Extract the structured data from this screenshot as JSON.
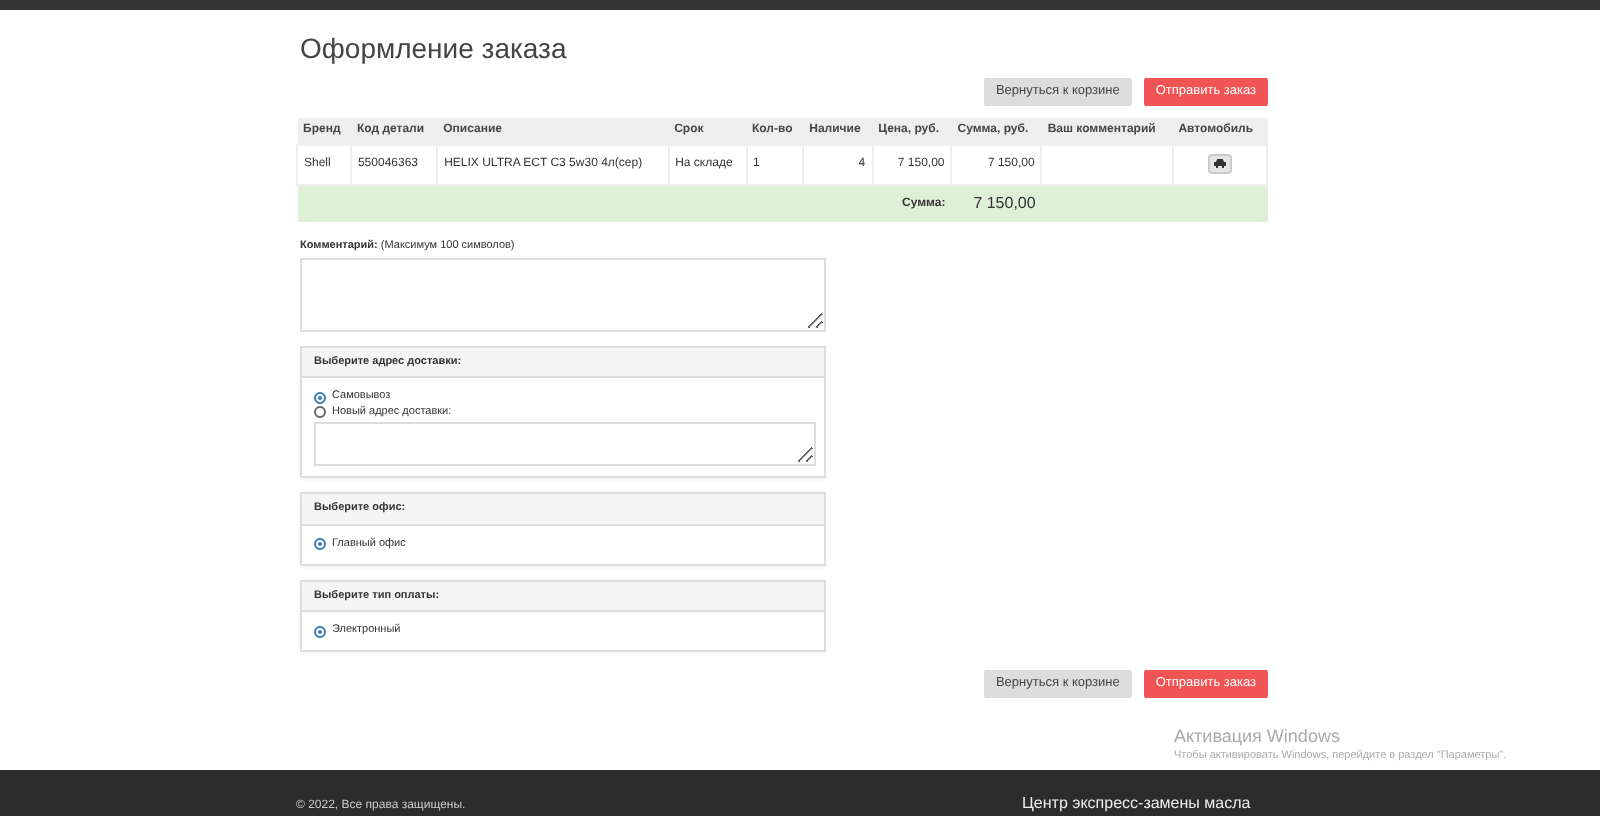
{
  "title": "Оформление заказа",
  "top_buttons": [
    {
      "kind": "back",
      "label": "Вернуться к корзине"
    },
    {
      "kind": "submit",
      "label": "Отправить заказ"
    }
  ],
  "table": {
    "columns": [
      "Бренд",
      "Код детали",
      "Описание",
      "Срок",
      "Кол-во",
      "Наличие",
      "Цена, руб.",
      "Сумма, руб.",
      "Ваш комментарий",
      "Автомобиль"
    ],
    "rows": [
      [
        "Shell",
        "550046363",
        "HELIX ULTRA ECT C3 5w30 4л(сер)",
        "На складе",
        "1",
        "4",
        "7 150,00",
        "7 150,00",
        ""
      ]
    ],
    "total_label": "Сумма:",
    "total_value": "7 150,00"
  },
  "comment": {
    "label": "Комментарий:",
    "hint": "(Максимум 100 символов)"
  },
  "panels": [
    {
      "title": "Выберите адрес доставки:",
      "options": [
        {
          "kind": "radio",
          "label": "Самовывоз",
          "selected": true
        },
        {
          "kind": "radio_with_field",
          "label": "Новый адрес доставки:",
          "selected": false
        }
      ]
    },
    {
      "title": "Выберите офис:",
      "options": [
        {
          "kind": "radio",
          "label": "Главный офис",
          "selected": true
        }
      ]
    },
    {
      "title": "Выберите тип оплаты:",
      "options": [
        {
          "kind": "radio",
          "label": "Электронный",
          "selected": true
        }
      ]
    }
  ],
  "bottom_buttons": [
    {
      "kind": "back",
      "label": "Вернуться к корзине"
    },
    {
      "kind": "submit",
      "label": "Отправить заказ"
    }
  ],
  "activation": {
    "title": "Активация Windows",
    "text": "Чтобы активировать Windows, перейдите в раздел \"Параметры\"."
  },
  "footer": {
    "copyright": "© 2022, Все права защищены.",
    "heading": "Центр экспресс-замены масла"
  }
}
